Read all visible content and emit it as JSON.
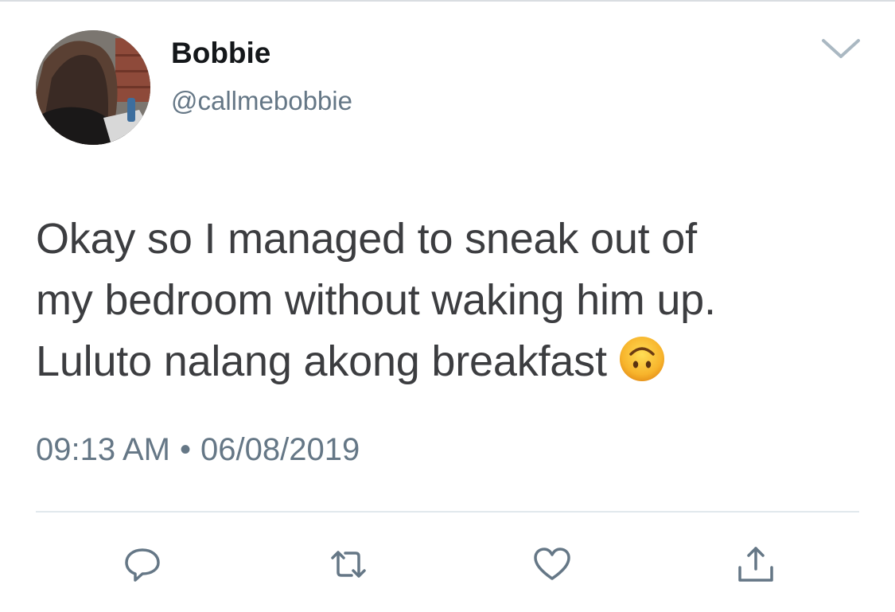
{
  "tweet": {
    "author": {
      "display_name": "Bobbie",
      "handle": "@callmebobbie"
    },
    "text_lines": [
      "Okay so I managed to sneak out of",
      "my bedroom without waking him up.",
      "Luluto nalang akong breakfast"
    ],
    "emoji": "upside-down-face",
    "time": "09:13 AM",
    "separator": "•",
    "date": "06/08/2019"
  },
  "actions": [
    {
      "name": "reply",
      "icon": "reply-icon"
    },
    {
      "name": "retweet",
      "icon": "retweet-icon"
    },
    {
      "name": "like",
      "icon": "heart-icon"
    },
    {
      "name": "share",
      "icon": "share-icon"
    }
  ],
  "colors": {
    "text": "#3c3d40",
    "secondary": "#657786",
    "divider": "#e1e8ed",
    "icon": "#657786"
  }
}
